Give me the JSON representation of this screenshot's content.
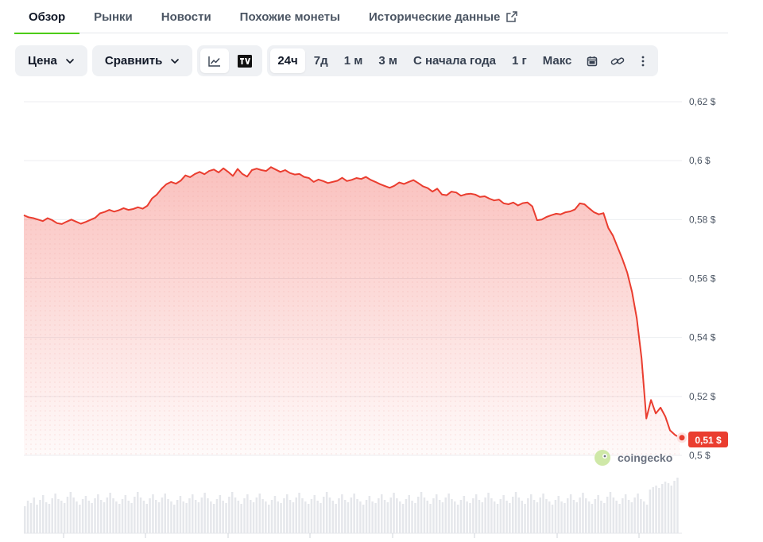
{
  "tabs": [
    {
      "label": "Обзор",
      "active": true
    },
    {
      "label": "Рынки"
    },
    {
      "label": "Новости"
    },
    {
      "label": "Похожие монеты"
    },
    {
      "label": "Исторические данные",
      "external": true
    }
  ],
  "toolbar": {
    "price_label": "Цена",
    "compare_label": "Сравнить",
    "chart_types": [
      {
        "icon": "line-chart-icon",
        "active": true
      },
      {
        "icon": "tradingview-icon"
      }
    ],
    "ranges": [
      "24ч",
      "7д",
      "1 м",
      "3 м",
      "С начала года",
      "1 г",
      "Макс"
    ],
    "active_range": "24ч",
    "extra_icons": [
      "calendar-icon",
      "link-icon",
      "more-icon"
    ]
  },
  "watermark": {
    "label": "coingecko"
  },
  "colors": {
    "accent": "#4bcc00",
    "line": "#ea3d2f",
    "badge": "#ea3d2f"
  },
  "chart_data": {
    "type": "area",
    "y_ticks": [
      {
        "value": 0.62,
        "label": "0,62 $"
      },
      {
        "value": 0.6,
        "label": "0,6 $"
      },
      {
        "value": 0.58,
        "label": "0,58 $"
      },
      {
        "value": 0.56,
        "label": "0,56 $"
      },
      {
        "value": 0.54,
        "label": "0,54 $"
      },
      {
        "value": 0.52,
        "label": "0,52 $"
      },
      {
        "value": 0.5,
        "label": "0,5 $"
      }
    ],
    "ylim": [
      0.5,
      0.62
    ],
    "grid": true,
    "current": {
      "value": 0.506,
      "label": "0,51 $"
    },
    "price": [
      0.5815,
      0.5808,
      0.5805,
      0.58,
      0.5795,
      0.5805,
      0.5798,
      0.5788,
      0.5785,
      0.5793,
      0.58,
      0.5793,
      0.5786,
      0.5792,
      0.5799,
      0.5806,
      0.5821,
      0.5826,
      0.5833,
      0.5827,
      0.5832,
      0.5839,
      0.5833,
      0.5836,
      0.5842,
      0.5837,
      0.5847,
      0.5872,
      0.5885,
      0.5905,
      0.592,
      0.5928,
      0.5922,
      0.5932,
      0.595,
      0.5944,
      0.5955,
      0.5962,
      0.5954,
      0.5965,
      0.597,
      0.596,
      0.5974,
      0.5962,
      0.5948,
      0.5972,
      0.5955,
      0.5946,
      0.5968,
      0.5973,
      0.5968,
      0.5965,
      0.5978,
      0.597,
      0.5962,
      0.5968,
      0.5958,
      0.5953,
      0.5955,
      0.5945,
      0.5941,
      0.5928,
      0.5936,
      0.5931,
      0.5924,
      0.5928,
      0.5932,
      0.5942,
      0.5931,
      0.5935,
      0.5941,
      0.5938,
      0.5945,
      0.5935,
      0.5928,
      0.592,
      0.5914,
      0.5908,
      0.5915,
      0.5926,
      0.5921,
      0.5928,
      0.5934,
      0.5924,
      0.5913,
      0.5907,
      0.5895,
      0.5905,
      0.5885,
      0.5883,
      0.5895,
      0.5892,
      0.5881,
      0.5886,
      0.5888,
      0.5885,
      0.5877,
      0.5879,
      0.5871,
      0.5865,
      0.5868,
      0.5855,
      0.5852,
      0.5858,
      0.5848,
      0.5856,
      0.5858,
      0.5845,
      0.5798,
      0.58,
      0.5809,
      0.5815,
      0.582,
      0.5818,
      0.5825,
      0.5828,
      0.5835,
      0.5855,
      0.5852,
      0.5838,
      0.5825,
      0.5818,
      0.5822,
      0.5772,
      0.5745,
      0.5705,
      0.5665,
      0.562,
      0.5555,
      0.5465,
      0.533,
      0.5125,
      0.5188,
      0.5142,
      0.5162,
      0.5132,
      0.5085,
      0.507,
      0.506
    ],
    "volume": [
      34,
      41,
      38,
      45,
      36,
      42,
      48,
      39,
      37,
      44,
      50,
      43,
      41,
      38,
      46,
      52,
      45,
      40,
      36,
      43,
      47,
      41,
      38,
      44,
      49,
      42,
      39,
      45,
      51,
      44,
      40,
      37,
      43,
      48,
      41,
      38,
      46,
      52,
      45,
      41,
      37,
      44,
      49,
      42,
      39,
      45,
      50,
      43,
      40,
      36,
      42,
      47,
      40,
      38,
      44,
      49,
      42,
      39,
      45,
      51,
      44,
      40,
      37,
      43,
      48,
      41,
      38,
      46,
      52,
      45,
      41,
      37,
      44,
      49,
      42,
      39,
      45,
      50,
      43,
      40,
      36,
      42,
      47,
      40,
      38,
      44,
      49,
      42,
      39,
      45,
      51,
      44,
      40,
      37,
      43,
      48,
      41,
      38,
      46,
      52,
      45,
      41,
      37,
      44,
      49,
      42,
      39,
      45,
      50,
      43,
      40,
      36,
      42,
      47,
      40,
      38,
      44,
      49,
      42,
      39,
      45,
      51,
      44,
      40,
      37,
      43,
      48,
      41,
      38,
      46,
      52,
      45,
      41,
      37,
      44,
      49,
      42,
      39,
      45,
      50,
      43,
      40,
      36,
      42,
      47,
      40,
      38,
      44,
      49,
      42,
      39,
      45,
      51,
      44,
      40,
      37,
      43,
      48,
      41,
      38,
      46,
      52,
      45,
      41,
      37,
      44,
      49,
      42,
      39,
      45,
      50,
      43,
      40,
      36,
      42,
      47,
      40,
      38,
      44,
      49,
      42,
      39,
      45,
      51,
      44,
      40,
      37,
      43,
      48,
      41,
      38,
      46,
      52,
      45,
      41,
      37,
      44,
      49,
      42,
      39,
      45,
      50,
      43,
      40,
      36,
      55,
      58,
      60,
      57,
      62,
      65,
      63,
      60,
      66,
      70
    ]
  }
}
